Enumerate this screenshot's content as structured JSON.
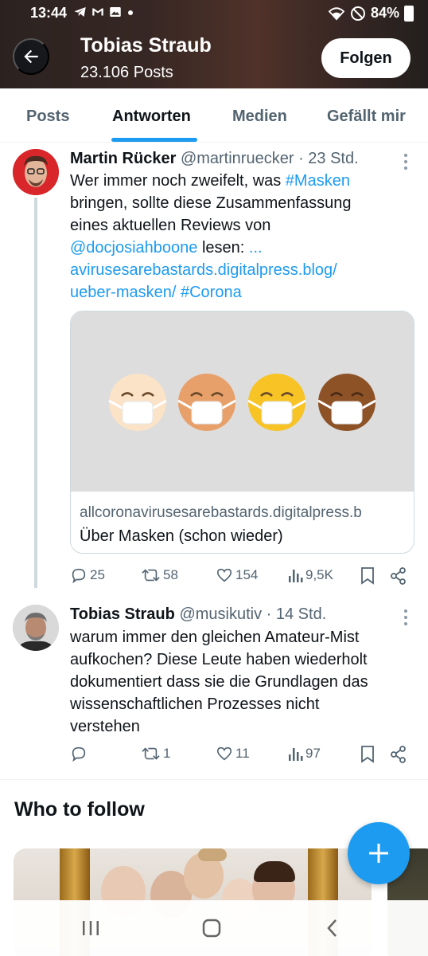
{
  "status_bar": {
    "time": "13:44",
    "battery": "84%",
    "left_icons": [
      "telegram-icon",
      "gmail-icon",
      "gallery-icon",
      "dot-icon"
    ],
    "right_icons": [
      "wifi-icon",
      "dnd-icon",
      "battery-icon"
    ]
  },
  "header": {
    "name": "Tobias Straub",
    "posts": "23.106 Posts",
    "follow_label": "Folgen"
  },
  "tabs": [
    {
      "label": "Posts",
      "active": false
    },
    {
      "label": "Antworten",
      "active": true
    },
    {
      "label": "Medien",
      "active": false
    },
    {
      "label": "Gefällt mir",
      "active": false
    }
  ],
  "tweets": [
    {
      "name": "Martin Rücker",
      "handle": "@martinruecker",
      "time": "· 23 Std.",
      "text_parts": {
        "l1a": "Wer immer noch zweifelt, was ",
        "l1b": "#Masken",
        "l2": "bringen, sollte diese Zusammenfassung",
        "l3": "eines aktuellen Reviews von",
        "l4a": "@docjosiahboone",
        "l4b": " lesen: ",
        "l4c": "...",
        "l5": "avirusesarebastards.digitalpress.blog/",
        "l6a": "ueber-masken/",
        "l6b": " ",
        "l6c": "#Corona"
      },
      "card": {
        "domain": "allcoronavirusesarebastards.digitalpress.b",
        "title": "Über Masken (schon wieder)",
        "face_colors": [
          "#fbe3c8",
          "#e8a06a",
          "#f7c325",
          "#8e5227"
        ]
      },
      "stats": {
        "replies": "25",
        "reposts": "58",
        "likes": "154",
        "views": "9,5K"
      }
    },
    {
      "name": "Tobias Straub",
      "handle": "@musikutiv",
      "time": "· 14 Std.",
      "text_lines": [
        "warum immer den gleichen Amateur-Mist",
        "aufkochen? Diese Leute haben wiederholt",
        "dokumentiert dass sie die Grundlagen das",
        "wissenschaftlichen Prozesses nicht",
        "verstehen"
      ],
      "stats": {
        "replies": "",
        "reposts": "1",
        "likes": "11",
        "views": "97"
      }
    }
  ],
  "who_to_follow": {
    "title": "Who to follow"
  },
  "colors": {
    "accent": "#1d9bf0",
    "text": "#0f1419",
    "muted": "#536471",
    "border": "#cfd9de"
  },
  "nav": {
    "icons": [
      "recent-apps-icon",
      "home-icon",
      "back-icon"
    ]
  }
}
